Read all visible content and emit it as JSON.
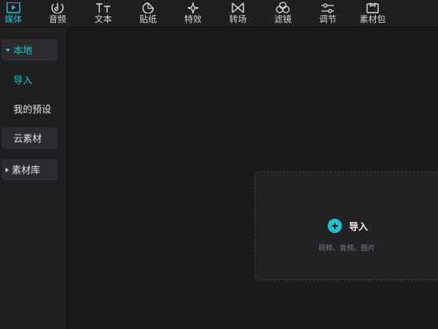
{
  "toolbar": {
    "tabs": [
      {
        "label": "媒体",
        "icon": "media-play-icon",
        "active": true
      },
      {
        "label": "音频",
        "icon": "music-note-icon",
        "active": false
      },
      {
        "label": "文本",
        "icon": "text-icon",
        "active": false
      },
      {
        "label": "贴纸",
        "icon": "sticker-icon",
        "active": false
      },
      {
        "label": "特效",
        "icon": "sparkle-icon",
        "active": false
      },
      {
        "label": "转场",
        "icon": "transition-icon",
        "active": false
      },
      {
        "label": "滤镜",
        "icon": "filter-icon",
        "active": false
      },
      {
        "label": "调节",
        "icon": "adjust-sliders-icon",
        "active": false
      },
      {
        "label": "素材包",
        "icon": "material-pack-icon",
        "active": false
      }
    ]
  },
  "sidebar": {
    "local": "本地",
    "import": "导入",
    "presets": "我的预设",
    "cloud": "云素材",
    "library": "素材库"
  },
  "main": {
    "import_label": "导入",
    "import_hint": "视频、音频、图片"
  },
  "colors": {
    "accent": "#22c0cc",
    "background": "#1b1b1d",
    "panel": "#1f1f22"
  }
}
